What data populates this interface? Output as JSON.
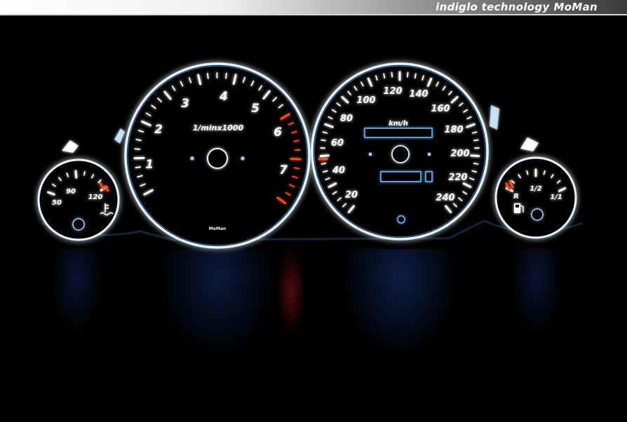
{
  "header": {
    "brand_text": "indiglo technology",
    "brand_name": "MoMan"
  },
  "tachometer": {
    "labels": [
      "1",
      "2",
      "3",
      "4",
      "5",
      "6",
      "7"
    ],
    "unit_label": "1/minx1000",
    "maker_label": "MoMan"
  },
  "speedometer": {
    "labels": [
      "20",
      "40",
      "60",
      "80",
      "100",
      "120",
      "140",
      "160",
      "180",
      "200",
      "220",
      "240"
    ],
    "unit_label": "km/h"
  },
  "temperature_gauge": {
    "labels": [
      "50",
      "90",
      "120"
    ]
  },
  "fuel_gauge": {
    "labels": [
      "R",
      "1/2",
      "1/1"
    ]
  },
  "colors": {
    "glow": "#7fc4ff",
    "redline": "#ff4a1a",
    "bezel": "#e8f4ff"
  }
}
